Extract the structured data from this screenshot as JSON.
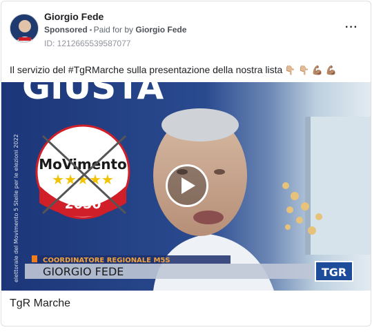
{
  "post": {
    "author": "Giorgio Fede",
    "sponsored_label": "Sponsored",
    "paid_for_prefix": "Paid for by",
    "paid_for_by": "Giorgio Fede",
    "ad_id": "ID: 1212665539587077",
    "more_icon": "more-horizontal-icon",
    "text": "Il servizio del #TgRMarche sulla presentazione della nostra lista",
    "emojis": "👇🏼 👇🏼 💪🏽 💪🏽"
  },
  "video": {
    "banner_text": "GIUSTA",
    "logo_word": "MoVimento",
    "logo_stars": "★★★★★",
    "logo_year": "2050",
    "side_text": "elettorale del Movimento 5 Stelle per le elezioni 2022",
    "lower_third_role": "COORDINATORE REGIONALE M5S",
    "lower_third_name": "GIORGIO FEDE",
    "channel_logo": "TGR",
    "play_icon": "play-icon"
  },
  "caption": "TgR Marche",
  "colors": {
    "accent_blue": "#1d3a86",
    "logo_red": "#d11f29",
    "text_primary": "#1c1e21",
    "text_secondary": "#606770"
  }
}
